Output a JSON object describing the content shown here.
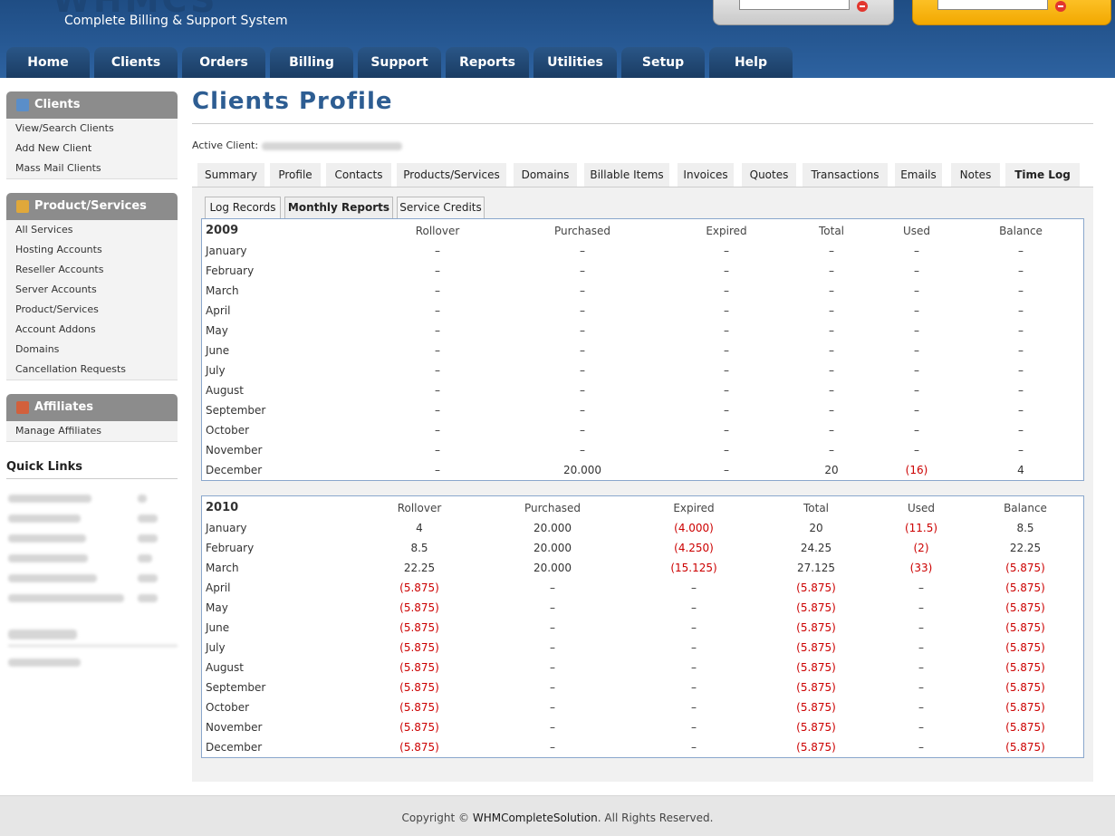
{
  "brand": {
    "logo": "WHMCS",
    "tagline": "Complete Billing & Support System"
  },
  "nav": [
    "Home",
    "Clients",
    "Orders",
    "Billing",
    "Support",
    "Reports",
    "Utilities",
    "Setup",
    "Help"
  ],
  "sidebar": {
    "clients": {
      "title": "Clients",
      "items": [
        "View/Search Clients",
        "Add New Client",
        "Mass Mail Clients"
      ]
    },
    "products": {
      "title": "Product/Services",
      "items": [
        "All Services",
        "Hosting Accounts",
        "Reseller Accounts",
        "Server Accounts",
        "Product/Services",
        "Account Addons",
        "Domains",
        "Cancellation Requests"
      ]
    },
    "affiliates": {
      "title": "Affiliates",
      "items": [
        "Manage Affiliates"
      ]
    },
    "quick_links_title": "Quick Links"
  },
  "page": {
    "title": "Clients Profile",
    "active_client_label": "Active Client:"
  },
  "tabs": [
    "Summary",
    "Profile",
    "Contacts",
    "Products/Services",
    "Domains",
    "Billable Items",
    "Invoices",
    "Quotes",
    "Transactions",
    "Emails",
    "Notes",
    "Time Log"
  ],
  "subtabs": [
    "Log Records",
    "Monthly Reports",
    "Service Credits"
  ],
  "columns": [
    "Rollover",
    "Purchased",
    "Expired",
    "Total",
    "Used",
    "Balance"
  ],
  "years": [
    {
      "year": "2009",
      "rows": [
        [
          "January",
          "–",
          "–",
          "–",
          "–",
          "–",
          "–"
        ],
        [
          "February",
          "–",
          "–",
          "–",
          "–",
          "–",
          "–"
        ],
        [
          "March",
          "–",
          "–",
          "–",
          "–",
          "–",
          "–"
        ],
        [
          "April",
          "–",
          "–",
          "–",
          "–",
          "–",
          "–"
        ],
        [
          "May",
          "–",
          "–",
          "–",
          "–",
          "–",
          "–"
        ],
        [
          "June",
          "–",
          "–",
          "–",
          "–",
          "–",
          "–"
        ],
        [
          "July",
          "–",
          "–",
          "–",
          "–",
          "–",
          "–"
        ],
        [
          "August",
          "–",
          "–",
          "–",
          "–",
          "–",
          "–"
        ],
        [
          "September",
          "–",
          "–",
          "–",
          "–",
          "–",
          "–"
        ],
        [
          "October",
          "–",
          "–",
          "–",
          "–",
          "–",
          "–"
        ],
        [
          "November",
          "–",
          "–",
          "–",
          "–",
          "–",
          "–"
        ],
        [
          "December",
          "–",
          "20.000",
          "–",
          "20",
          "(16)",
          "4"
        ]
      ]
    },
    {
      "year": "2010",
      "rows": [
        [
          "January",
          "4",
          "20.000",
          "(4.000)",
          "20",
          "(11.5)",
          "8.5"
        ],
        [
          "February",
          "8.5",
          "20.000",
          "(4.250)",
          "24.25",
          "(2)",
          "22.25"
        ],
        [
          "March",
          "22.25",
          "20.000",
          "(15.125)",
          "27.125",
          "(33)",
          "(5.875)"
        ],
        [
          "April",
          "(5.875)",
          "–",
          "–",
          "(5.875)",
          "–",
          "(5.875)"
        ],
        [
          "May",
          "(5.875)",
          "–",
          "–",
          "(5.875)",
          "–",
          "(5.875)"
        ],
        [
          "June",
          "(5.875)",
          "–",
          "–",
          "(5.875)",
          "–",
          "(5.875)"
        ],
        [
          "July",
          "(5.875)",
          "–",
          "–",
          "(5.875)",
          "–",
          "(5.875)"
        ],
        [
          "August",
          "(5.875)",
          "–",
          "–",
          "(5.875)",
          "–",
          "(5.875)"
        ],
        [
          "September",
          "(5.875)",
          "–",
          "–",
          "(5.875)",
          "–",
          "(5.875)"
        ],
        [
          "October",
          "(5.875)",
          "–",
          "–",
          "(5.875)",
          "–",
          "(5.875)"
        ],
        [
          "November",
          "(5.875)",
          "–",
          "–",
          "(5.875)",
          "–",
          "(5.875)"
        ],
        [
          "December",
          "(5.875)",
          "–",
          "–",
          "(5.875)",
          "–",
          "(5.875)"
        ]
      ]
    }
  ],
  "footer": {
    "prefix": "Copyright ©",
    "company": "WHMCompleteSolution",
    "suffix": ". All Rights Reserved."
  },
  "colors": {
    "header": "#2d62a0",
    "title": "#2d5d92",
    "negative": "#cc0000",
    "sidebar_head": "#8c8c8c",
    "table_border": "#8aa7cc"
  }
}
